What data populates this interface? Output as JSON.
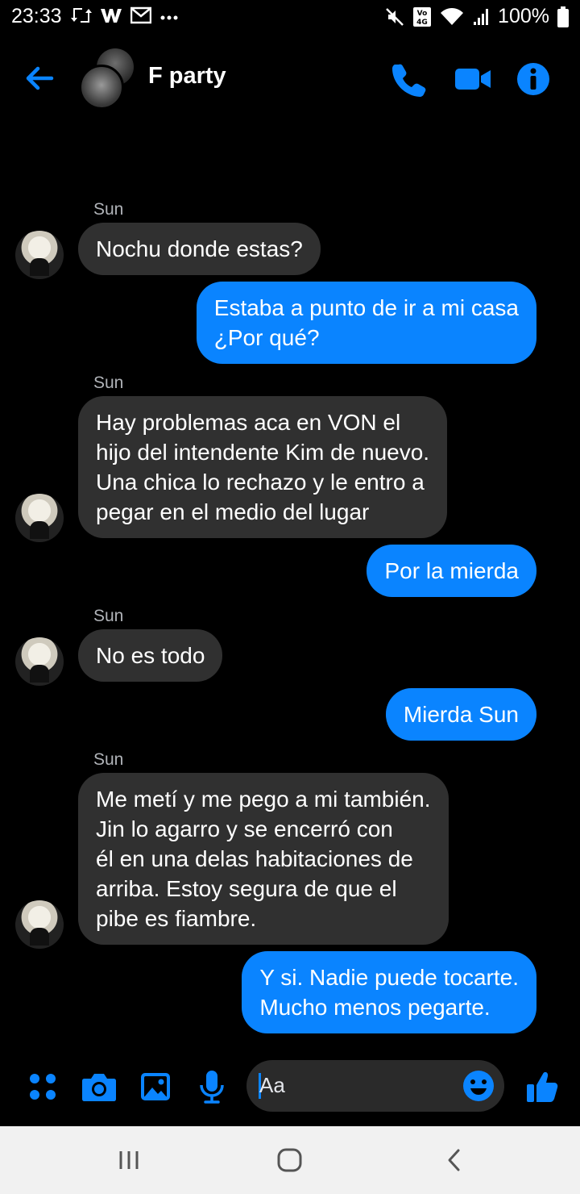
{
  "status_bar": {
    "time": "23:33",
    "battery_text": "100%",
    "icons_left": [
      "retweet-icon",
      "w-app-icon",
      "gmail-icon",
      "more-dots-icon"
    ],
    "icons_right": [
      "mute-icon",
      "volte-4g-icon",
      "wifi-icon",
      "signal-icon",
      "battery-icon"
    ]
  },
  "header": {
    "title": "F party",
    "icons": [
      "back-arrow-icon",
      "phone-icon",
      "video-icon",
      "info-icon"
    ],
    "accent_color": "#0a84ff"
  },
  "messages": [
    {
      "direction": "in",
      "sender": "Sun",
      "text": "Nochu donde estas?"
    },
    {
      "direction": "out",
      "text": "Estaba a punto de ir a mi casa\n¿Por qué?"
    },
    {
      "direction": "in",
      "sender": "Sun",
      "text": "Hay problemas aca en VON el\nhijo del intendente Kim de nuevo.\nUna chica lo rechazo y le entro a\npegar en el medio del lugar"
    },
    {
      "direction": "out",
      "text": "Por la mierda"
    },
    {
      "direction": "in",
      "sender": "Sun",
      "text": "No es todo"
    },
    {
      "direction": "out",
      "text": "Mierda Sun"
    },
    {
      "direction": "in",
      "sender": "Sun",
      "text": "Me metí y me pego a mi también.\nJin lo agarro y se encerró con\nél en una delas habitaciones de\narriba. Estoy segura de que el\npibe es fiambre."
    },
    {
      "direction": "out",
      "text": "Y si. Nadie puede tocarte.\nMucho menos pegarte."
    }
  ],
  "composer": {
    "placeholder": "Aa",
    "icons": [
      "apps-grid-icon",
      "camera-icon",
      "gallery-icon",
      "microphone-icon",
      "emoji-icon",
      "thumbs-up-icon"
    ]
  },
  "nav_bar": {
    "icons": [
      "recent-apps-icon",
      "home-icon",
      "back-icon"
    ]
  },
  "colors": {
    "background": "#000000",
    "incoming_bubble": "#303030",
    "outgoing_bubble": "#0a84ff",
    "sender_label": "#b0b3b8"
  }
}
